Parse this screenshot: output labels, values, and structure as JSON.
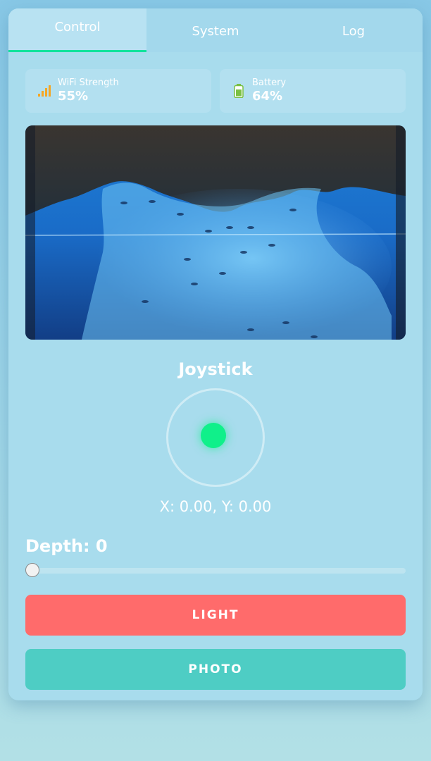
{
  "tabs": [
    {
      "label": "Control",
      "active": true
    },
    {
      "label": "System",
      "active": false
    },
    {
      "label": "Log",
      "active": false
    }
  ],
  "stats": {
    "wifi": {
      "icon": "signal-bars-icon",
      "label": "WiFi Strength",
      "value": "55%"
    },
    "battery": {
      "icon": "battery-icon",
      "label": "Battery",
      "value": "64%"
    }
  },
  "camera": {
    "alt": "Underwater camera feed"
  },
  "joystick": {
    "title": "Joystick",
    "coords": "X: 0.00, Y: 0.00",
    "x": 0.0,
    "y": 0.0
  },
  "depth": {
    "label": "Depth: 0",
    "value": 0
  },
  "buttons": {
    "light": "LIGHT",
    "photo": "PHOTO"
  },
  "colors": {
    "accent": "#12e39c",
    "light_button": "#ff6b6b",
    "photo_button": "#4ecdc4",
    "joystick_knob": "#10f08a"
  }
}
